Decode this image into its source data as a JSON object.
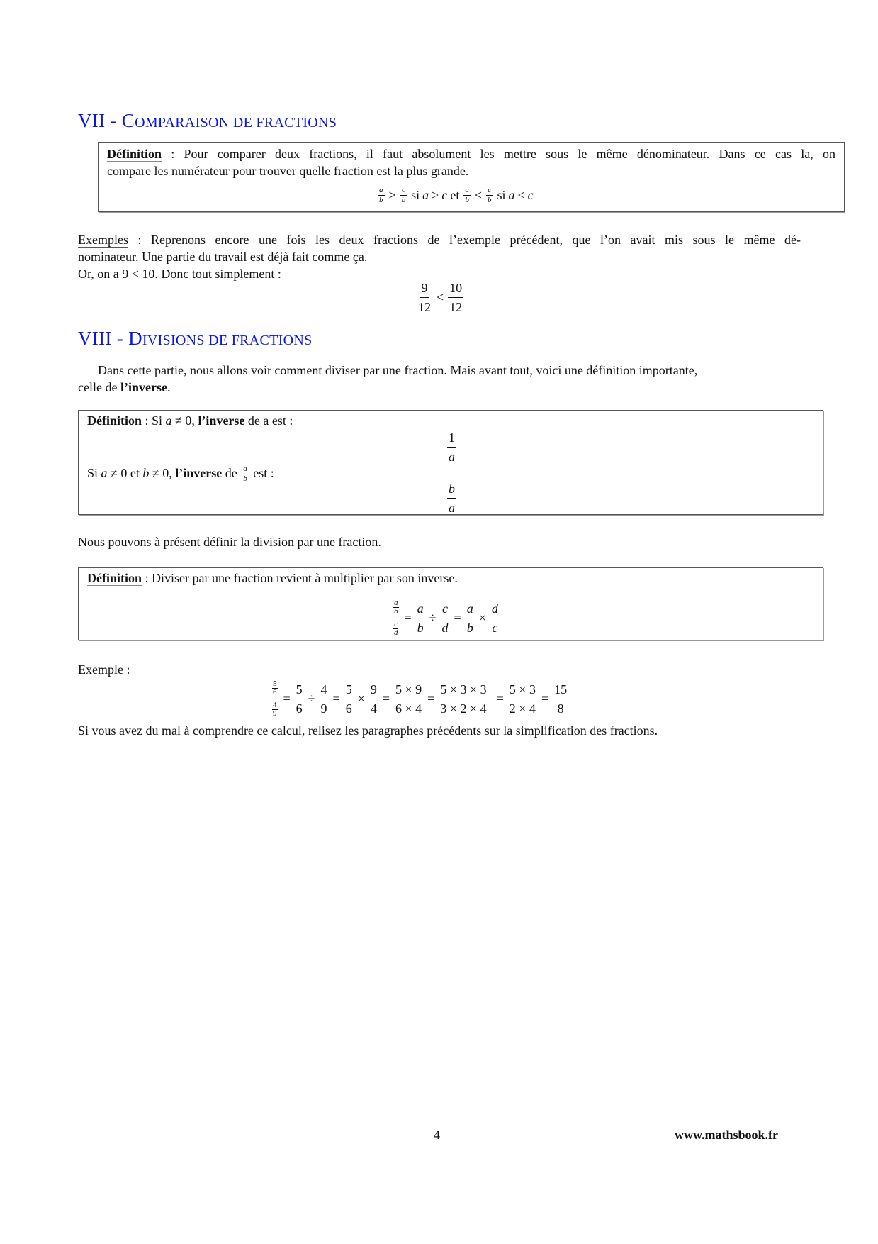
{
  "section7": {
    "number": "VII -",
    "title_cap": "C",
    "title_rest": "omparaison de fractions",
    "definition": {
      "label": "Définition",
      "sep": " : ",
      "text_line1": "Pour comparer deux fractions, il faut absolument les mettre sous le même dénominateur. Dans ce cas la, on",
      "text_line2": "compare les numérateur pour trouver quelle fraction est la plus grande.",
      "formula": {
        "f1n": "a",
        "f1d": "b",
        "op1": ">",
        "f2n": "c",
        "f2d": "b",
        "cond1": "si",
        "cond1_expr_a": "a",
        "cond1_op": ">",
        "cond1_expr_c": "c",
        "conj": "et",
        "f3n": "a",
        "f3d": "b",
        "op2": "<",
        "f4n": "c",
        "f4d": "b",
        "cond2": "si",
        "cond2_expr_a": "a",
        "cond2_op": "<",
        "cond2_expr_c": "c"
      }
    },
    "example": {
      "label": "Exemples",
      "sep": " : ",
      "line1": "Reprenons encore une fois les deux fractions de l’exemple précédent, que l’on avait mis sous le même dé-",
      "line2": "nominateur. Une partie du travail est déjà fait comme ça.",
      "line3": "Or, on a 9 < 10. Donc tout simplement :",
      "formula": {
        "f1n": "9",
        "f1d": "12",
        "op": "<",
        "f2n": "10",
        "f2d": "12"
      }
    }
  },
  "section8": {
    "number": "VIII -",
    "title_cap": "D",
    "title_rest": "ivisions de fractions",
    "intro_line1": "Dans cette partie, nous allons voir comment diviser par une fraction. Mais avant tout, voici une définition importante,",
    "intro_line2_pre": "celle de ",
    "intro_line2_bold": "l’inverse",
    "intro_line2_post": ".",
    "def_inverse": {
      "label": "Définition",
      "sep": " : ",
      "line1_pre": "Si ",
      "line1_var": "a",
      "line1_cond": " ≠ 0, ",
      "line1_bold": "l’inverse",
      "line1_post": " de a est :",
      "frac1n": "1",
      "frac1d": "a",
      "line2_pre": "Si ",
      "line2_var_a": "a",
      "line2_mid1": " ≠ 0 et ",
      "line2_var_b": "b",
      "line2_mid2": " ≠ 0, ",
      "line2_bold": "l’inverse",
      "line2_de": " de ",
      "line2_fn": "a",
      "line2_fd": "b",
      "line2_post": " est :",
      "frac2n": "b",
      "frac2d": "a"
    },
    "transition": "Nous pouvons à présent définir la division par une fraction.",
    "def_division": {
      "label": "Définition",
      "sep": " : ",
      "text": "Diviser par une fraction revient à multiplier par son inverse.",
      "formula": {
        "cn": "a",
        "cd": "b",
        "cn2": "c",
        "cd2": "d",
        "eq1": "=",
        "f1n": "a",
        "f1d": "b",
        "div": "÷",
        "f2n": "c",
        "f2d": "d",
        "eq2": "=",
        "f3n": "a",
        "f3d": "b",
        "times": "×",
        "f4n": "d",
        "f4d": "c"
      }
    },
    "example": {
      "label": "Exemple",
      "sep": " :",
      "formula": {
        "cn": "5",
        "cd": "6",
        "cn2": "4",
        "cd2": "9",
        "eq": "=",
        "s1n": "5",
        "s1d": "6",
        "div": "÷",
        "s2n": "4",
        "s2d": "9",
        "s3n": "5",
        "s3d": "6",
        "times": "×",
        "s4n": "9",
        "s4d": "4",
        "s5n": "5 × 9",
        "s5d": "6 × 4",
        "s6n": "5 × 3 × 3",
        "s6d": "3 × 2 × 4",
        "s7n": "5 × 3",
        "s7d": "2 × 4",
        "s8n": "15",
        "s8d": "8"
      },
      "note": "Si vous avez du mal à comprendre ce calcul, relisez les paragraphes précédents sur la simplification des fractions."
    }
  },
  "footer": {
    "page_number": "4",
    "website": "www.mathsbook.fr"
  }
}
